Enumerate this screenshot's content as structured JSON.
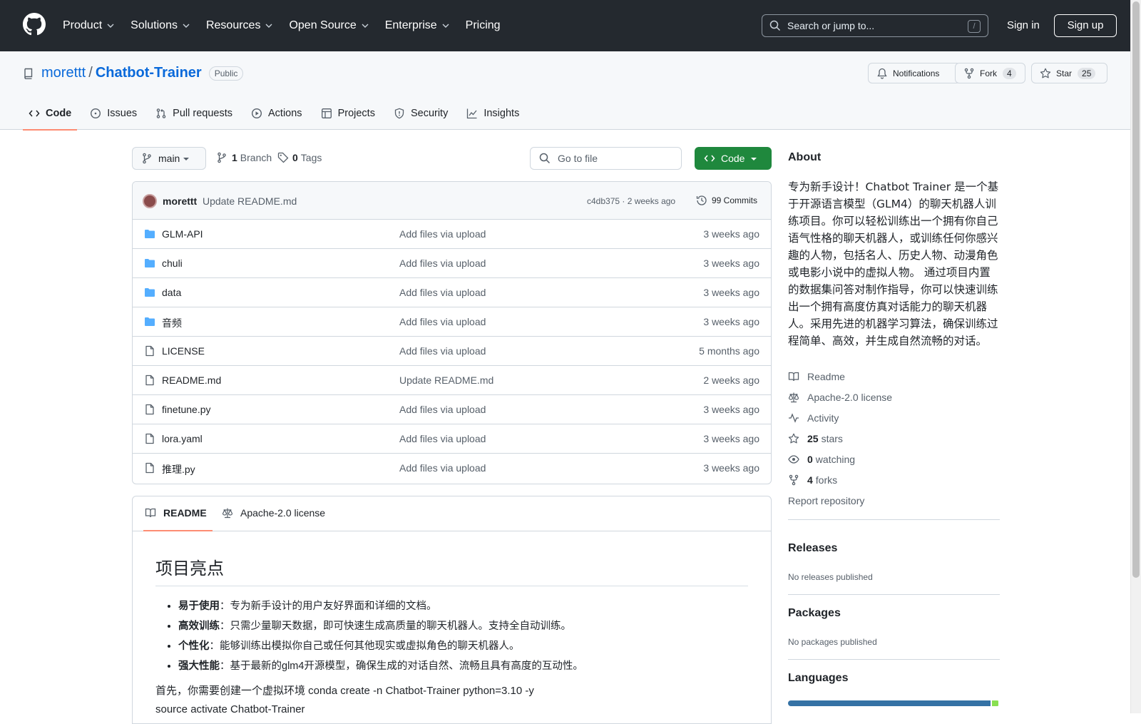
{
  "header": {
    "nav": [
      "Product",
      "Solutions",
      "Resources",
      "Open Source",
      "Enterprise",
      "Pricing"
    ],
    "search_placeholder": "Search or jump to...",
    "search_shortcut": "/",
    "sign_in": "Sign in",
    "sign_up": "Sign up"
  },
  "repo": {
    "owner": "morettt",
    "separator": "/",
    "name": "Chatbot-Trainer",
    "visibility": "Public",
    "notifications_label": "Notifications",
    "fork_label": "Fork",
    "fork_count": "4",
    "star_label": "Star",
    "star_count": "25",
    "tabs": [
      "Code",
      "Issues",
      "Pull requests",
      "Actions",
      "Projects",
      "Security",
      "Insights"
    ]
  },
  "toolbar": {
    "branch": "main",
    "branch_count": "1",
    "branch_word": "Branch",
    "tag_count": "0",
    "tag_word": "Tags",
    "go_to_file": "Go to file",
    "code_button": "Code"
  },
  "commit": {
    "author": "morettt",
    "message": "Update README.md",
    "hash_age": "c4db375 · 2 weeks ago",
    "commits": "99 Commits"
  },
  "files": [
    {
      "type": "folder",
      "name": "GLM-API",
      "message": "Add files via upload",
      "age": "3 weeks ago"
    },
    {
      "type": "folder",
      "name": "chuli",
      "message": "Add files via upload",
      "age": "3 weeks ago"
    },
    {
      "type": "folder",
      "name": "data",
      "message": "Add files via upload",
      "age": "3 weeks ago"
    },
    {
      "type": "folder",
      "name": "音频",
      "message": "Add files via upload",
      "age": "3 weeks ago"
    },
    {
      "type": "file",
      "name": "LICENSE",
      "message": "Add files via upload",
      "age": "5 months ago"
    },
    {
      "type": "file",
      "name": "README.md",
      "message": "Update README.md",
      "age": "2 weeks ago"
    },
    {
      "type": "file",
      "name": "finetune.py",
      "message": "Add files via upload",
      "age": "3 weeks ago"
    },
    {
      "type": "file",
      "name": "lora.yaml",
      "message": "Add files via upload",
      "age": "3 weeks ago"
    },
    {
      "type": "file",
      "name": "推理.py",
      "message": "Add files via upload",
      "age": "3 weeks ago"
    }
  ],
  "readme": {
    "tab_readme": "README",
    "tab_license": "Apache-2.0 license",
    "heading": "项目亮点",
    "bullets": [
      {
        "bold": "易于使用",
        "text": "：专为新手设计的用户友好界面和详细的文档。"
      },
      {
        "bold": "高效训练",
        "text": "：只需少量聊天数据，即可快速生成高质量的聊天机器人。支持全自动训练。"
      },
      {
        "bold": "个性化",
        "text": "：能够训练出模拟你自己或任何其他现实或虚拟角色的聊天机器人。"
      },
      {
        "bold": "强大性能",
        "text": "：基于最新的glm4开源模型，确保生成的对话自然、流畅且具有高度的互动性。"
      }
    ],
    "para1": "首先，你需要创建一个虚拟环境 conda create -n Chatbot-Trainer python=3.10 -y",
    "para2": "source activate Chatbot-Trainer"
  },
  "about": {
    "title": "About",
    "description": "专为新手设计！Chatbot Trainer 是一个基于开源语言模型（GLM4）的聊天机器人训练项目。你可以轻松训练出一个拥有你自己语气性格的聊天机器人，或训练任何你感兴趣的人物，包括名人、历史人物、动漫角色或电影小说中的虚拟人物。 通过项目内置的数据集问答对制作指导，你可以快速训练出一个拥有高度仿真对话能力的聊天机器人。采用先进的机器学习算法，确保训练过程简单、高效，并生成自然流畅的对话。",
    "readme": "Readme",
    "license": "Apache-2.0 license",
    "activity": "Activity",
    "stars_count": "25",
    "stars_word": "stars",
    "watching_count": "0",
    "watching_word": "watching",
    "forks_count": "4",
    "forks_word": "forks",
    "report": "Report repository"
  },
  "releases": {
    "title": "Releases",
    "empty": "No releases published"
  },
  "packages": {
    "title": "Packages",
    "empty": "No packages published"
  },
  "languages": {
    "title": "Languages",
    "bar": [
      {
        "color": "#3572A5",
        "share": 0.97
      },
      {
        "color": "#89e051",
        "share": 0.03
      }
    ]
  },
  "colors": {
    "header_bg": "#24292f",
    "accent": "#0969da",
    "green": "#1f883d",
    "tab_underline": "#fd8c73"
  }
}
